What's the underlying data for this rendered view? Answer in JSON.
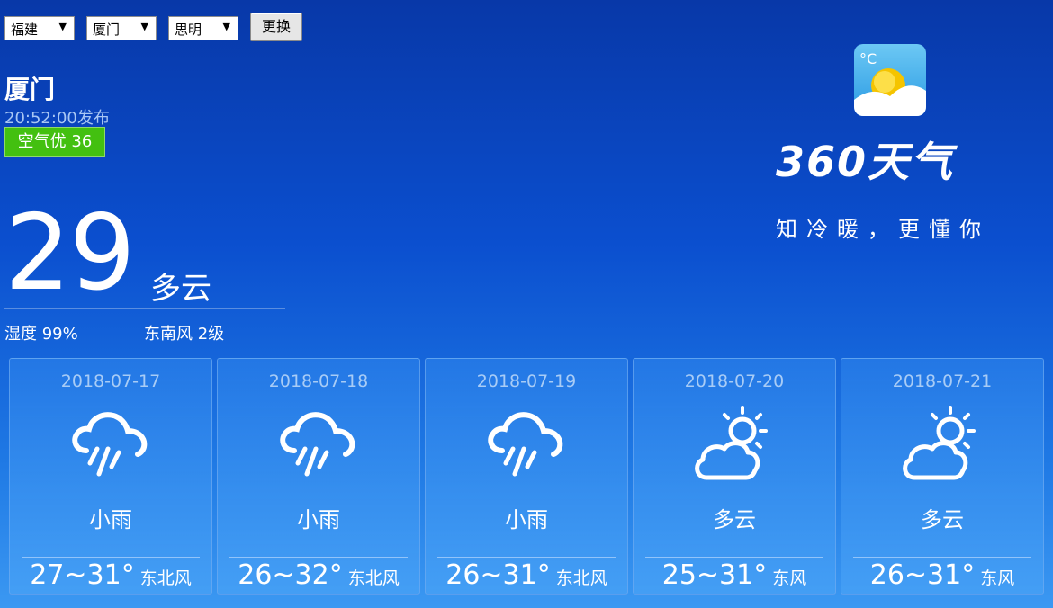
{
  "location": {
    "province": "福建",
    "city": "厦门",
    "district": "思明",
    "swap_label": "更换"
  },
  "current": {
    "city": "厦门",
    "publish_time": "20:52:00发布",
    "air_quality": "空气优 36",
    "temperature": "29",
    "condition": "多云",
    "humidity": "湿度 99%",
    "wind": "东南风 2级"
  },
  "brand": {
    "name": "360天气",
    "slogan": "知冷暖，更懂你",
    "icon_text": "°C",
    "icon": "weather-app-icon"
  },
  "forecast": [
    {
      "date": "2018-07-17",
      "icon": "rain-cloud-icon",
      "condition": "小雨",
      "temp": "27~31°",
      "wind": "东北风"
    },
    {
      "date": "2018-07-18",
      "icon": "rain-cloud-icon",
      "condition": "小雨",
      "temp": "26~32°",
      "wind": "东北风"
    },
    {
      "date": "2018-07-19",
      "icon": "rain-cloud-icon",
      "condition": "小雨",
      "temp": "26~31°",
      "wind": "东北风"
    },
    {
      "date": "2018-07-20",
      "icon": "sun-cloud-icon",
      "condition": "多云",
      "temp": "25~31°",
      "wind": "东风"
    },
    {
      "date": "2018-07-21",
      "icon": "sun-cloud-icon",
      "condition": "多云",
      "temp": "26~31°",
      "wind": "东风"
    }
  ],
  "colors": {
    "aqi_good": "#43c010",
    "background_top": "#0838a8",
    "background_bottom": "#3b98f2"
  }
}
